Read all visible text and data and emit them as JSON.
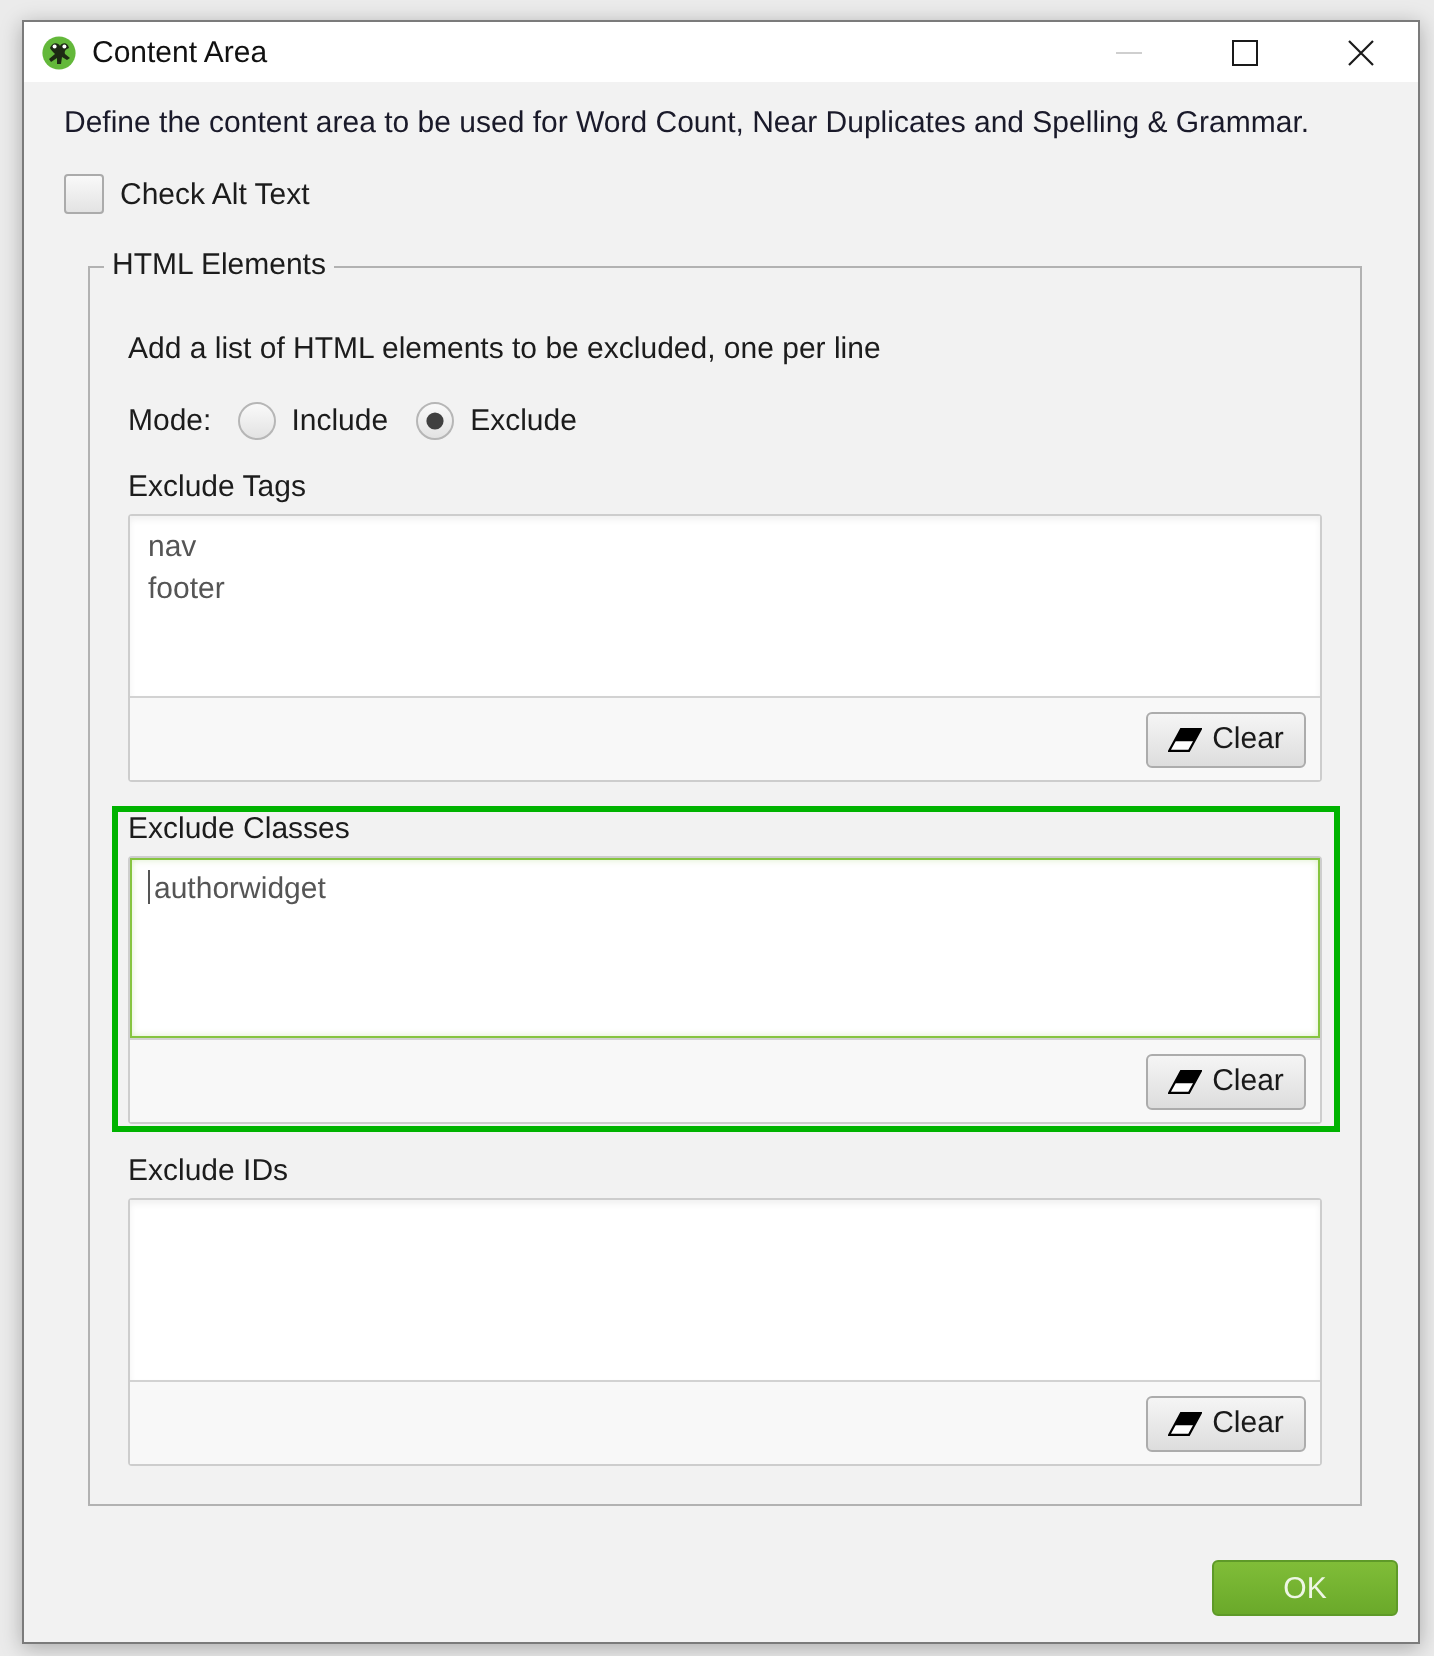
{
  "window": {
    "title": "Content Area",
    "minimize_disabled": true
  },
  "description": "Define the content area to be used for Word Count, Near Duplicates and Spelling & Grammar.",
  "check_alt_text": {
    "label": "Check Alt Text",
    "checked": false
  },
  "html_elements": {
    "title": "HTML Elements",
    "instruction": "Add a list of HTML elements to be excluded, one per line",
    "mode": {
      "label": "Mode:",
      "options": [
        {
          "label": "Include",
          "selected": false
        },
        {
          "label": "Exclude",
          "selected": true
        }
      ]
    },
    "sections": [
      {
        "label": "Exclude Tags",
        "lines": [
          "nav",
          "footer"
        ],
        "focused": false,
        "highlighted": false,
        "clear_button": "Clear"
      },
      {
        "label": "Exclude Classes",
        "lines": [
          "authorwidget"
        ],
        "focused": true,
        "highlighted": true,
        "clear_button": "Clear"
      },
      {
        "label": "Exclude IDs",
        "focused": false,
        "highlighted": false,
        "clear_button": "Clear"
      }
    ]
  },
  "ok_button": "OK"
}
